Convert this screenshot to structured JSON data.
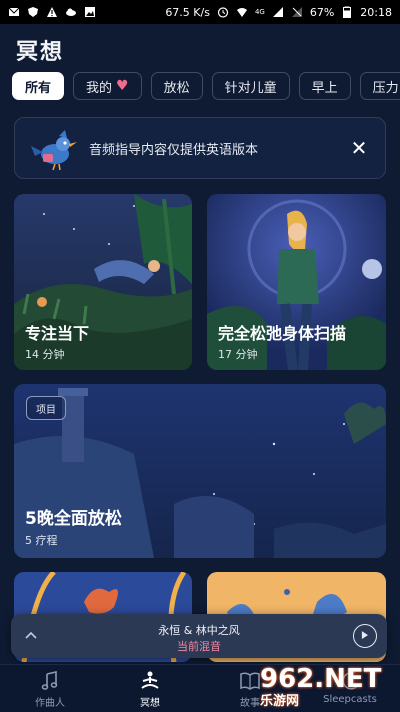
{
  "status_bar": {
    "speed": "67.5 K/s",
    "network": "4G",
    "battery": "67%",
    "time": "20:18"
  },
  "page": {
    "title": "冥想"
  },
  "filters": {
    "items": [
      {
        "label": "所有",
        "active": true
      },
      {
        "label": "我的",
        "active": false,
        "icon": "heart-icon"
      },
      {
        "label": "放松",
        "active": false
      },
      {
        "label": "针对儿童",
        "active": false
      },
      {
        "label": "早上",
        "active": false
      },
      {
        "label": "压力",
        "active": false
      }
    ]
  },
  "notice": {
    "text": "音频指导内容仅提供英语版本",
    "close_icon": "close-icon",
    "illustration": "bird-illustration"
  },
  "cards": [
    {
      "title": "专注当下",
      "subtitle": "14 分钟"
    },
    {
      "title": "完全松弛身体扫描",
      "subtitle": "17 分钟"
    },
    {
      "tag": "项目",
      "title": "5晚全面放松",
      "subtitle": "5 疗程"
    }
  ],
  "now_playing": {
    "title": "永恒 & 林中之风",
    "subtitle": "当前混音"
  },
  "tabs": [
    {
      "label": "作曲人",
      "icon": "music-note-icon",
      "active": false
    },
    {
      "label": "冥想",
      "icon": "meditation-icon",
      "active": true
    },
    {
      "label": "故事",
      "icon": "book-icon",
      "active": false
    },
    {
      "label": "Sleepcasts",
      "icon": "moon-icon",
      "active": false
    }
  ],
  "watermark": {
    "logo": "962.NET",
    "text": "乐游网"
  },
  "colors": {
    "background": "#0f1b33",
    "accent_pink": "#f06c8d",
    "card_blue": "#1b2a50"
  }
}
